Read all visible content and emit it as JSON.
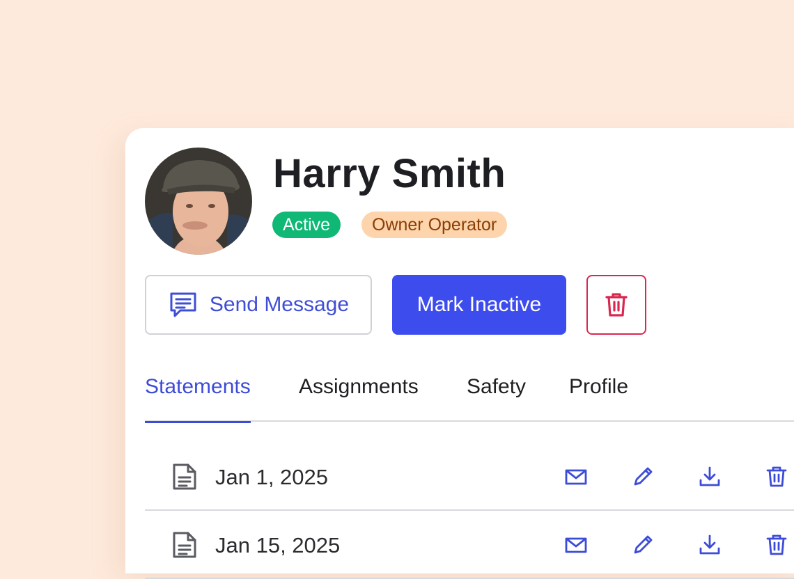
{
  "profile": {
    "name": "Harry Smith",
    "status_badge": "Active",
    "role_badge": "Owner Operator"
  },
  "actions": {
    "send_message": "Send Message",
    "mark_inactive": "Mark Inactive"
  },
  "tabs": [
    {
      "label": "Statements",
      "active": true
    },
    {
      "label": "Assignments",
      "active": false
    },
    {
      "label": "Safety",
      "active": false
    },
    {
      "label": "Profile",
      "active": false
    }
  ],
  "statements": [
    {
      "date": "Jan 1, 2025"
    },
    {
      "date": "Jan 15, 2025"
    }
  ],
  "colors": {
    "background": "#feeadc",
    "accent": "#3d4cec",
    "active_badge": "#0fb874",
    "role_badge": "#fdd4ac",
    "danger": "#d9284f"
  },
  "icons": {
    "message": "message-square-icon",
    "delete": "trash-icon",
    "document": "document-icon",
    "email": "mail-icon",
    "edit": "pencil-icon",
    "download": "download-icon"
  }
}
